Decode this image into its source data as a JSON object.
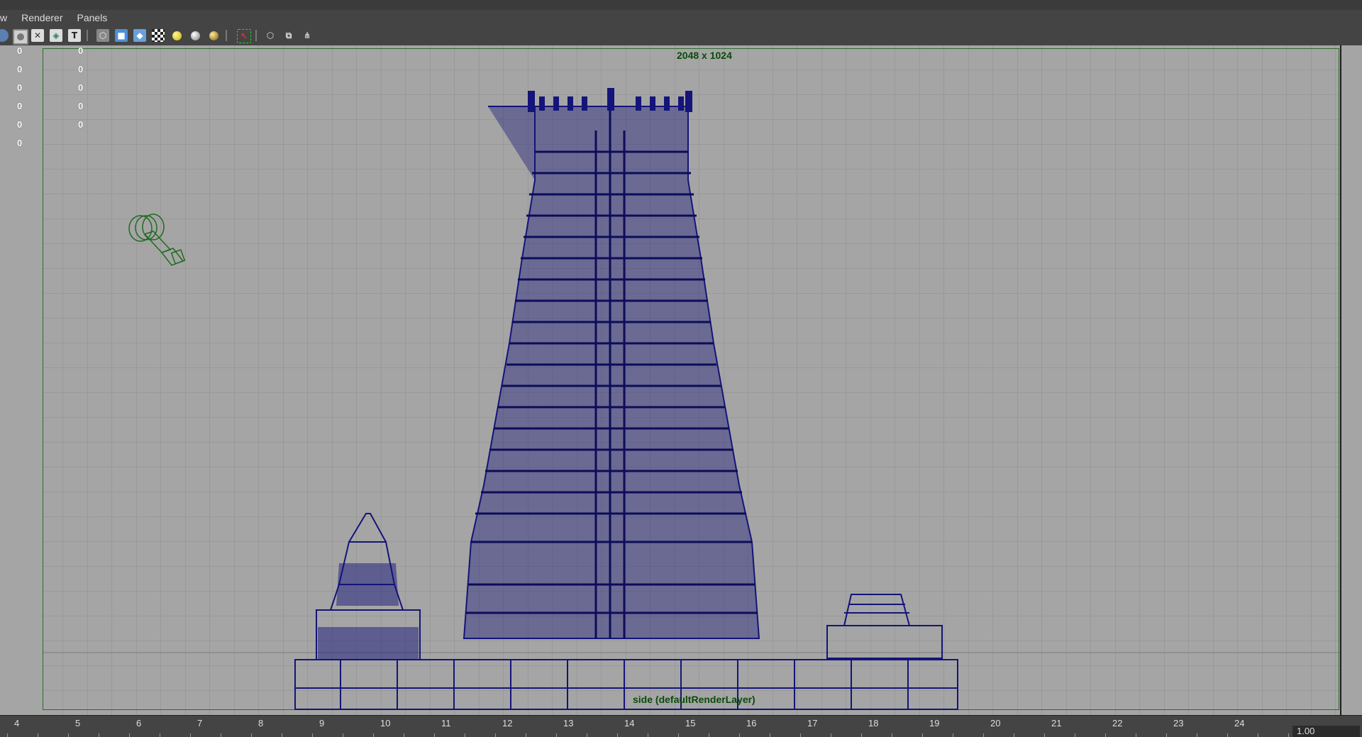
{
  "menu": {
    "items": [
      "w",
      "Renderer",
      "Panels"
    ]
  },
  "toolbar": {
    "buttons": [
      {
        "icon": "shaded-icon",
        "glyph": ""
      },
      {
        "icon": "smooth-shaded-icon",
        "glyph": ""
      },
      {
        "icon": "wireframe-icon",
        "glyph": ""
      },
      {
        "icon": "bounding-box-icon",
        "glyph": ""
      },
      {
        "icon": "textured-icon",
        "glyph": "T"
      },
      {
        "icon": "wireframe-cube-icon",
        "glyph": ""
      },
      {
        "icon": "solid-cube-icon",
        "glyph": ""
      },
      {
        "icon": "shaded-cube-icon",
        "glyph": ""
      },
      {
        "icon": "checker-icon",
        "glyph": ""
      },
      {
        "icon": "default-light-icon",
        "glyph": ""
      },
      {
        "icon": "all-lights-icon",
        "glyph": ""
      },
      {
        "icon": "shadows-icon",
        "glyph": ""
      },
      {
        "icon": "xray-select-icon",
        "glyph": ""
      },
      {
        "icon": "isolate-icon",
        "glyph": ""
      },
      {
        "icon": "film-gate-icon",
        "glyph": ""
      },
      {
        "icon": "hypergraph-icon",
        "glyph": ""
      }
    ]
  },
  "hud": {
    "col1": [
      "0",
      "0",
      "0",
      "0",
      "0",
      "0"
    ],
    "col2": [
      "0",
      "0",
      "0",
      "0",
      "0"
    ]
  },
  "viewport": {
    "resolution_label": "2048 x 1024",
    "camera_label": "side (defaultRenderLayer)"
  },
  "timeline": {
    "ticks": [
      "4",
      "5",
      "6",
      "7",
      "8",
      "9",
      "10",
      "11",
      "12",
      "13",
      "14",
      "15",
      "16",
      "17",
      "18",
      "19",
      "20",
      "21",
      "22",
      "23",
      "24"
    ],
    "current_frame": "1.00"
  },
  "colors": {
    "wireframe": "#14147a",
    "camera_wire": "#1f6b1f",
    "grid": "#8e8e8e",
    "viewport_bg": "#a5a5a5"
  }
}
